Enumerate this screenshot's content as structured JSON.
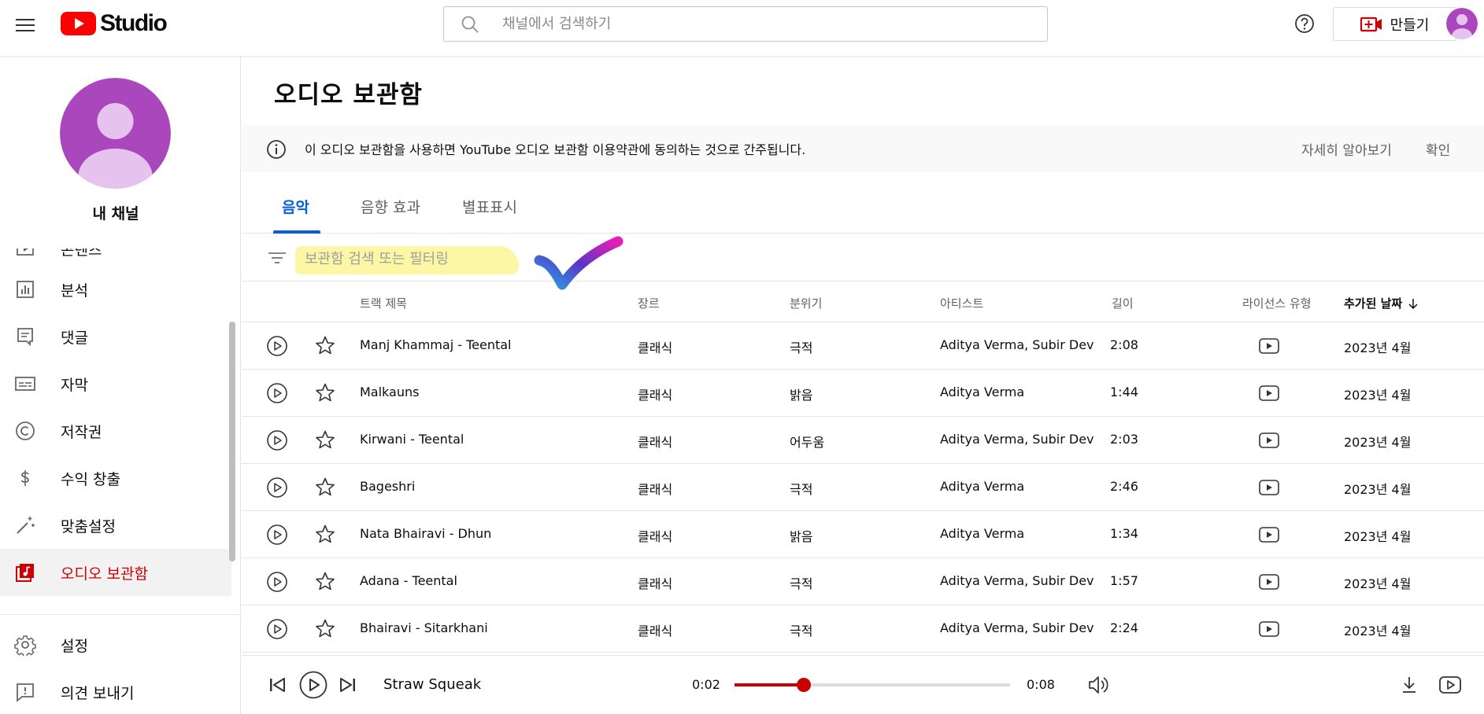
{
  "header": {
    "logo_text": "Studio",
    "search_placeholder": "채널에서 검색하기",
    "create_label": "만들기"
  },
  "sidebar": {
    "channel_name": "내 채널",
    "items": [
      {
        "label": "콘텐츠",
        "icon": "content-icon"
      },
      {
        "label": "분석",
        "icon": "analytics-icon"
      },
      {
        "label": "댓글",
        "icon": "comments-icon"
      },
      {
        "label": "자막",
        "icon": "subtitles-icon"
      },
      {
        "label": "저작권",
        "icon": "copyright-icon"
      },
      {
        "label": "수익 창출",
        "icon": "dollar-icon"
      },
      {
        "label": "맞춤설정",
        "icon": "magic-wand-icon"
      },
      {
        "label": "오디오 보관함",
        "icon": "audio-library-icon",
        "active": true
      }
    ],
    "bottom_items": [
      {
        "label": "설정",
        "icon": "gear-icon"
      },
      {
        "label": "의견 보내기",
        "icon": "feedback-icon"
      }
    ]
  },
  "main": {
    "title": "오디오 보관함",
    "notice": {
      "message": "이 오디오 보관함을 사용하면 YouTube 오디오 보관함 이용약관에 동의하는 것으로 간주됩니다.",
      "learn_more": "자세히 알아보기",
      "confirm": "확인"
    },
    "tabs": [
      {
        "label": "음악",
        "active": true
      },
      {
        "label": "음향 효과"
      },
      {
        "label": "별표표시"
      }
    ],
    "filter_placeholder": "보관함 검색 또는 필터링",
    "columns": {
      "title": "트랙 제목",
      "genre": "장르",
      "mood": "분위기",
      "artist": "아티스트",
      "length": "길이",
      "license": "라이선스 유형",
      "added": "추가된 날짜"
    },
    "rows": [
      {
        "title": "Manj Khammaj - Teental",
        "genre": "클래식",
        "mood": "극적",
        "artist": "Aditya Verma, Subir Dev",
        "length": "2:08",
        "added": "2023년 4월"
      },
      {
        "title": "Malkauns",
        "genre": "클래식",
        "mood": "밝음",
        "artist": "Aditya Verma",
        "length": "1:44",
        "added": "2023년 4월"
      },
      {
        "title": "Kirwani - Teental",
        "genre": "클래식",
        "mood": "어두움",
        "artist": "Aditya Verma, Subir Dev",
        "length": "2:03",
        "added": "2023년 4월"
      },
      {
        "title": "Bageshri",
        "genre": "클래식",
        "mood": "극적",
        "artist": "Aditya Verma",
        "length": "2:46",
        "added": "2023년 4월"
      },
      {
        "title": "Nata Bhairavi - Dhun",
        "genre": "클래식",
        "mood": "밝음",
        "artist": "Aditya Verma",
        "length": "1:34",
        "added": "2023년 4월"
      },
      {
        "title": "Adana - Teental",
        "genre": "클래식",
        "mood": "극적",
        "artist": "Aditya Verma, Subir Dev",
        "length": "1:57",
        "added": "2023년 4월"
      },
      {
        "title": "Bhairavi - Sitarkhani",
        "genre": "클래식",
        "mood": "극적",
        "artist": "Aditya Verma, Subir Dev",
        "length": "2:24",
        "added": "2023년 4월"
      }
    ]
  },
  "player": {
    "track_title": "Straw Squeak",
    "current_time": "0:02",
    "duration": "0:08",
    "progress_fraction": 0.25
  },
  "colors": {
    "accent_blue": "#065fd4",
    "brand_red": "#cc0000",
    "avatar_purple": "#ab47bc",
    "highlight_yellow": "#fbf69a"
  }
}
